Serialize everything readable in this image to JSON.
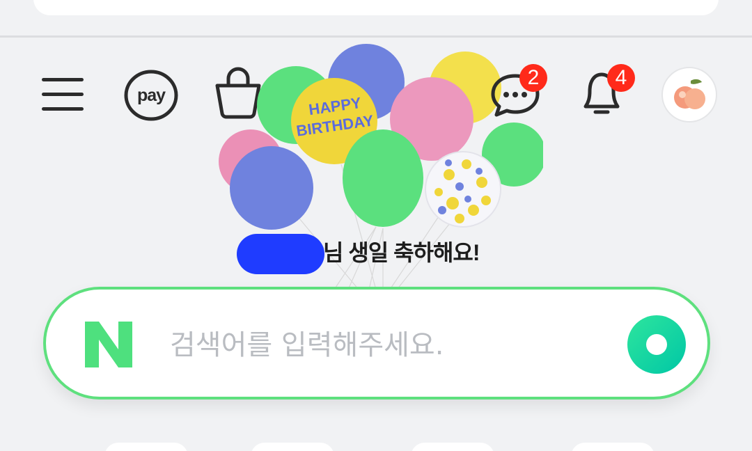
{
  "header": {
    "pay_label": "pay",
    "chat_badge_count": "2",
    "notification_badge_count": "4"
  },
  "banner": {
    "balloon_text_line1": "HAPPY",
    "balloon_text_line2": "BIRTHDAY",
    "greeting_suffix": "님 생일 축하해요!"
  },
  "search": {
    "placeholder": "검색어를 입력해주세요.",
    "logo_letter": "N"
  },
  "colors": {
    "accent_green": "#5ee07e",
    "badge_red": "#ff2a1a",
    "redaction_blue": "#1f3cff"
  },
  "icons": [
    "menu-icon",
    "naver-pay-icon",
    "shopping-bag-icon",
    "chat-bubble-icon",
    "bell-icon",
    "profile-avatar"
  ]
}
